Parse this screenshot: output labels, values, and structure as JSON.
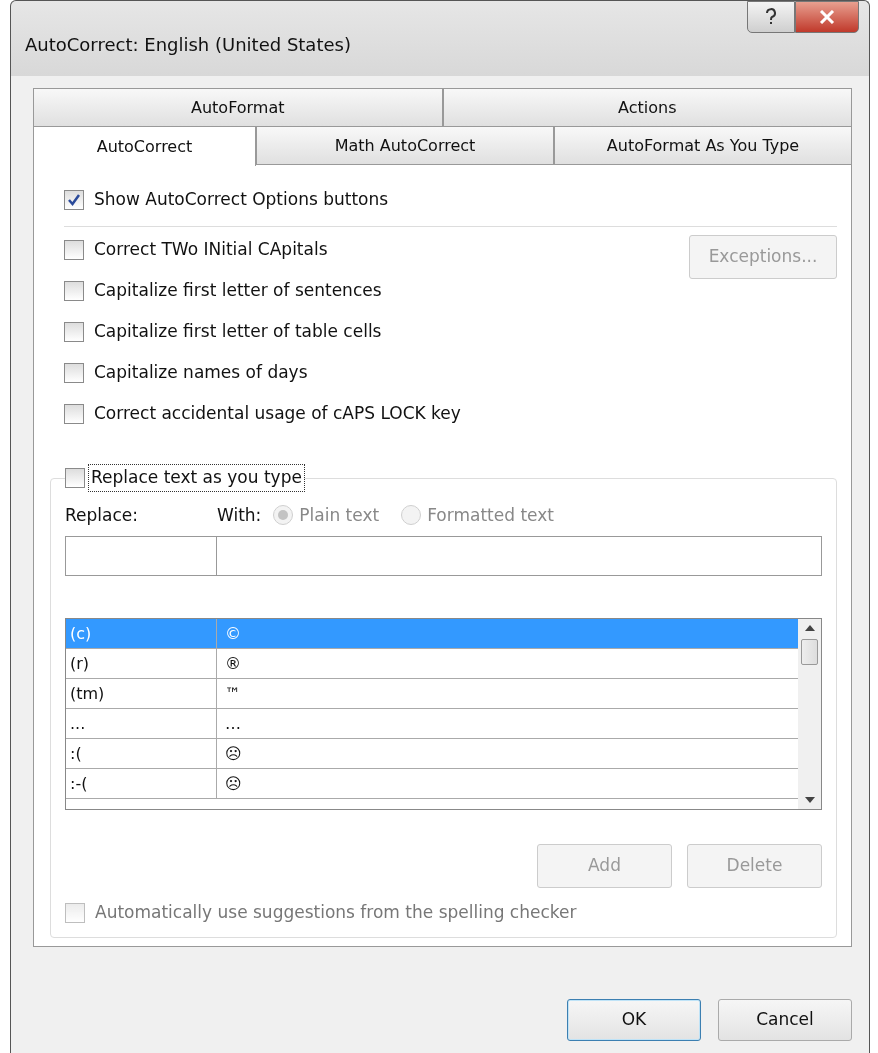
{
  "window": {
    "title": "AutoCorrect: English (United States)"
  },
  "tab_rows": [
    {
      "tabs": [
        {
          "label": "AutoFormat",
          "selected": false
        },
        {
          "label": "Actions",
          "selected": false
        }
      ]
    },
    {
      "tabs": [
        {
          "label": "AutoCorrect",
          "selected": true
        },
        {
          "label": "Math AutoCorrect",
          "selected": false
        },
        {
          "label": "AutoFormat As You Type",
          "selected": false
        }
      ]
    }
  ],
  "show_options": {
    "label": "Show AutoCorrect Options buttons",
    "checked": true
  },
  "options": [
    {
      "label": "Correct TWo INitial CApitals",
      "checked": false
    },
    {
      "label": "Capitalize first letter of sentences",
      "checked": false
    },
    {
      "label": "Capitalize first letter of table cells",
      "checked": false
    },
    {
      "label": "Capitalize names of days",
      "checked": false
    },
    {
      "label": "Correct accidental usage of cAPS LOCK key",
      "checked": false
    }
  ],
  "exceptions_button": {
    "label": "Exceptions...",
    "disabled": true
  },
  "replace_group": {
    "checkbox": {
      "label": "Replace text as you type",
      "checked": false
    },
    "replace_label": "Replace:",
    "with_label": "With:",
    "radios": [
      {
        "label": "Plain text",
        "selected": true,
        "disabled": true
      },
      {
        "label": "Formatted text",
        "selected": false,
        "disabled": true
      }
    ],
    "entries": [
      {
        "replace": "(c)",
        "with": "©",
        "selected": true
      },
      {
        "replace": "(r)",
        "with": "®",
        "selected": false
      },
      {
        "replace": "(tm)",
        "with": "™",
        "selected": false
      },
      {
        "replace": "...",
        "with": "…",
        "selected": false
      },
      {
        "replace": ":(",
        "with": "☹",
        "selected": false
      },
      {
        "replace": ":-(",
        "with": "☹",
        "selected": false
      }
    ],
    "buttons": [
      {
        "label": "Add",
        "disabled": true
      },
      {
        "label": "Delete",
        "disabled": true
      }
    ],
    "suggestions": {
      "label": "Automatically use suggestions from the spelling checker",
      "checked": false,
      "disabled": true
    }
  },
  "footer_buttons": [
    {
      "label": "OK",
      "default": true
    },
    {
      "label": "Cancel",
      "default": false
    }
  ]
}
